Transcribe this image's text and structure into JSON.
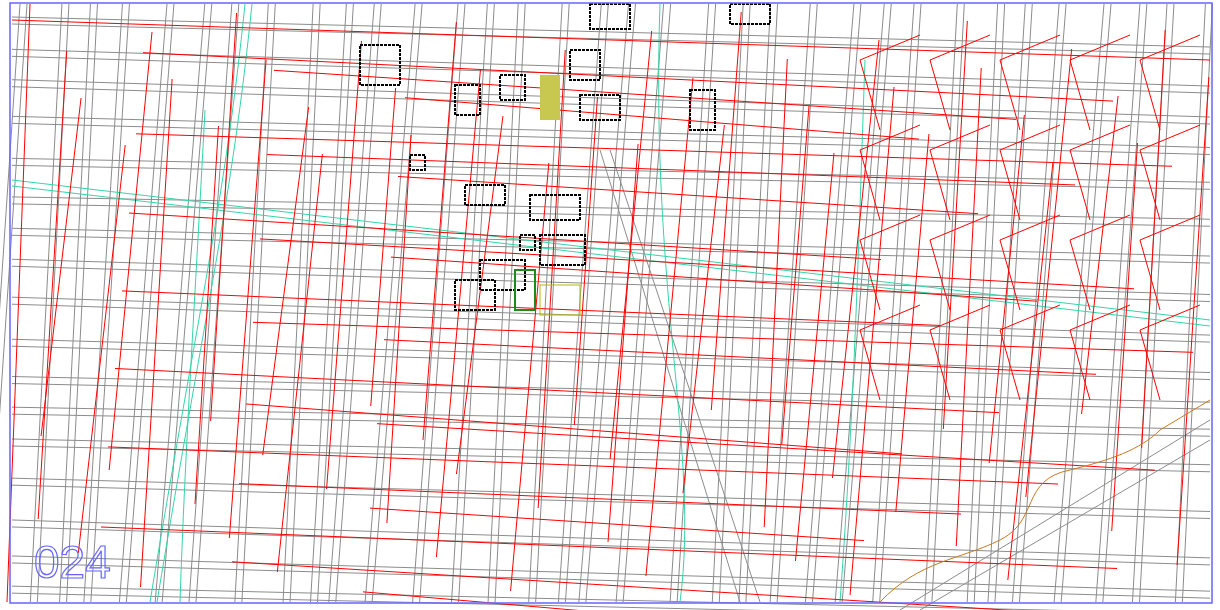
{
  "drawing": {
    "sheet_number": "024"
  }
}
